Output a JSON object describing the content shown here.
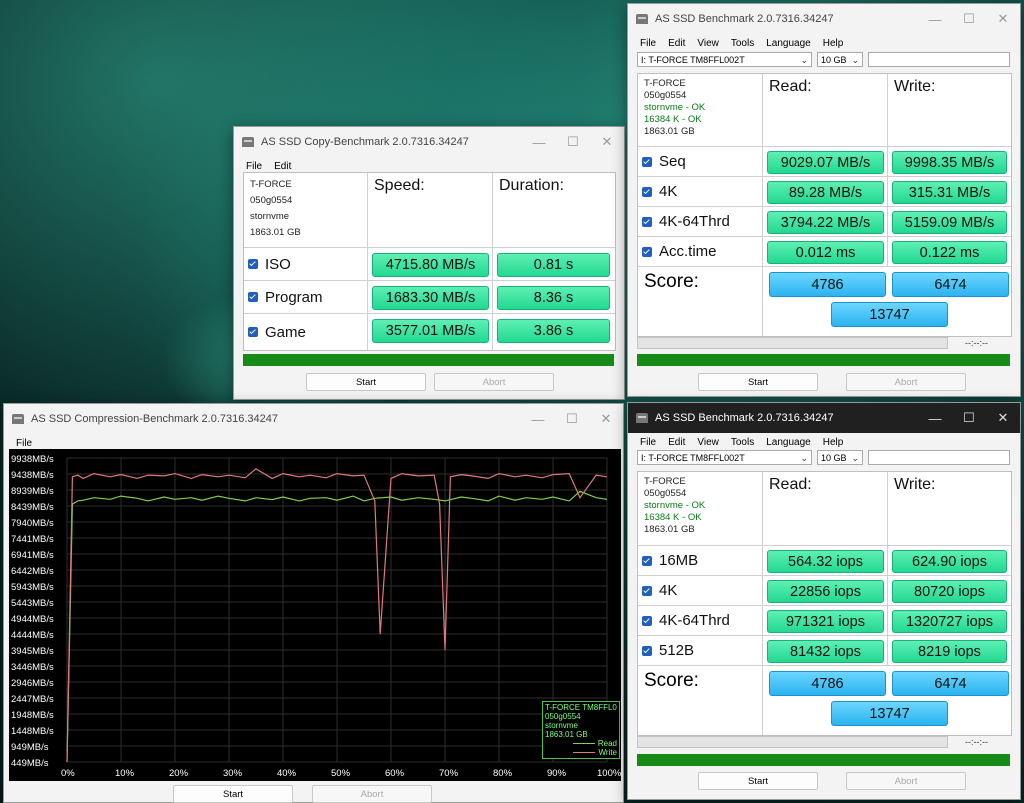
{
  "copy": {
    "title": "AS SSD Copy-Benchmark 2.0.7316.34247",
    "menu": [
      "File",
      "Edit"
    ],
    "info": [
      "T-FORCE",
      "050g0554",
      "stornvme",
      "1863.01 GB"
    ],
    "headers": {
      "speed": "Speed:",
      "duration": "Duration:"
    },
    "rows": [
      {
        "label": "ISO",
        "speed": "4715.80 MB/s",
        "duration": "0.81 s"
      },
      {
        "label": "Program",
        "speed": "1683.30 MB/s",
        "duration": "8.36 s"
      },
      {
        "label": "Game",
        "speed": "3577.01 MB/s",
        "duration": "3.86 s"
      }
    ],
    "start": "Start",
    "abort": "Abort"
  },
  "bench1": {
    "title": "AS SSD Benchmark 2.0.7316.34247",
    "menu": [
      "File",
      "Edit",
      "View",
      "Tools",
      "Language",
      "Help"
    ],
    "drive": "I: T-FORCE TM8FFL002T",
    "size": "10 GB",
    "info": {
      "name": "T-FORCE",
      "fw": "050g0554",
      "driver": "stornvme - OK",
      "align": "16384 K - OK",
      "cap": "1863.01 GB"
    },
    "headers": {
      "read": "Read:",
      "write": "Write:"
    },
    "rows": [
      {
        "label": "Seq",
        "read": "9029.07 MB/s",
        "write": "9998.35 MB/s"
      },
      {
        "label": "4K",
        "read": "89.28 MB/s",
        "write": "315.31 MB/s"
      },
      {
        "label": "4K-64Thrd",
        "read": "3794.22 MB/s",
        "write": "5159.09 MB/s"
      },
      {
        "label": "Acc.time",
        "read": "0.012 ms",
        "write": "0.122 ms"
      }
    ],
    "score_label": "Score:",
    "score": {
      "read": "4786",
      "write": "6474",
      "total": "13747"
    },
    "timer": "--:--:--",
    "start": "Start",
    "abort": "Abort"
  },
  "bench2": {
    "title": "AS SSD Benchmark 2.0.7316.34247",
    "menu": [
      "File",
      "Edit",
      "View",
      "Tools",
      "Language",
      "Help"
    ],
    "drive": "I: T-FORCE TM8FFL002T",
    "size": "10 GB",
    "info": {
      "name": "T-FORCE",
      "fw": "050g0554",
      "driver": "stornvme - OK",
      "align": "16384 K - OK",
      "cap": "1863.01 GB"
    },
    "headers": {
      "read": "Read:",
      "write": "Write:"
    },
    "rows": [
      {
        "label": "16MB",
        "read": "564.32 iops",
        "write": "624.90 iops"
      },
      {
        "label": "4K",
        "read": "22856 iops",
        "write": "80720 iops"
      },
      {
        "label": "4K-64Thrd",
        "read": "971321 iops",
        "write": "1320727 iops"
      },
      {
        "label": "512B",
        "read": "81432 iops",
        "write": "8219 iops"
      }
    ],
    "score_label": "Score:",
    "score": {
      "read": "4786",
      "write": "6474",
      "total": "13747"
    },
    "timer": "--:--:--",
    "start": "Start",
    "abort": "Abort"
  },
  "compression": {
    "title": "AS SSD Compression-Benchmark 2.0.7316.34247",
    "menu": [
      "File"
    ],
    "legend": {
      "drive": "T-FORCE TM8FFL0",
      "fw": "050g0554",
      "driver": "stornvme",
      "cap": "1863.01 GB",
      "read": "Read",
      "write": "Write"
    },
    "start": "Start",
    "abort": "Abort",
    "colors": {
      "read": "#7fd24a",
      "write": "#e07a7a"
    }
  },
  "chart_data": {
    "type": "line",
    "xlabel": "",
    "ylabel": "",
    "x_ticks": [
      "0%",
      "10%",
      "20%",
      "30%",
      "40%",
      "50%",
      "60%",
      "70%",
      "80%",
      "90%",
      "100%"
    ],
    "y_ticks": [
      "9938MB/s",
      "9438MB/s",
      "8939MB/s",
      "8439MB/s",
      "7940MB/s",
      "7441MB/s",
      "6941MB/s",
      "6442MB/s",
      "5943MB/s",
      "5443MB/s",
      "4944MB/s",
      "4444MB/s",
      "3945MB/s",
      "3446MB/s",
      "2946MB/s",
      "2447MB/s",
      "1948MB/s",
      "1448MB/s",
      "949MB/s",
      "449MB/s"
    ],
    "ylim": [
      449,
      9938
    ],
    "series": [
      {
        "name": "Read",
        "x": [
          0,
          1,
          2,
          3,
          5,
          8,
          10,
          13,
          15,
          18,
          20,
          23,
          25,
          28,
          30,
          33,
          35,
          38,
          40,
          43,
          45,
          48,
          50,
          53,
          55,
          57,
          60,
          62,
          65,
          68,
          70,
          73,
          75,
          78,
          80,
          83,
          85,
          88,
          90,
          93,
          95,
          98,
          100
        ],
        "y": [
          449,
          8500,
          8600,
          8620,
          8700,
          8650,
          8750,
          8680,
          8600,
          8720,
          8650,
          8700,
          8620,
          8750,
          8680,
          8600,
          8700,
          8640,
          8720,
          8600,
          8680,
          8700,
          8620,
          8750,
          8600,
          8680,
          8720,
          8620,
          8700,
          8650,
          8600,
          8720,
          8680,
          8600,
          8750,
          8620,
          8700,
          8650,
          8720,
          8600,
          8900,
          8700,
          8650
        ]
      },
      {
        "name": "Write",
        "x": [
          0,
          1,
          2,
          3,
          5,
          8,
          10,
          13,
          15,
          18,
          20,
          23,
          25,
          28,
          30,
          33,
          35,
          38,
          40,
          43,
          45,
          48,
          50,
          53,
          55,
          57,
          58,
          60,
          62,
          65,
          68,
          69,
          70,
          71,
          73,
          75,
          78,
          80,
          83,
          85,
          88,
          90,
          93,
          95,
          98,
          100
        ],
        "y": [
          449,
          9350,
          9400,
          9300,
          9450,
          9350,
          9420,
          9300,
          9400,
          9380,
          9450,
          9300,
          9420,
          9350,
          9400,
          9320,
          9600,
          9300,
          9450,
          9350,
          9400,
          9320,
          9450,
          9380,
          9400,
          8600,
          4444,
          9300,
          9450,
          9380,
          9400,
          8500,
          3945,
          9350,
          9420,
          9380,
          9300,
          9450,
          9350,
          9400,
          9320,
          9420,
          9450,
          8700,
          9400,
          9350
        ]
      }
    ]
  }
}
